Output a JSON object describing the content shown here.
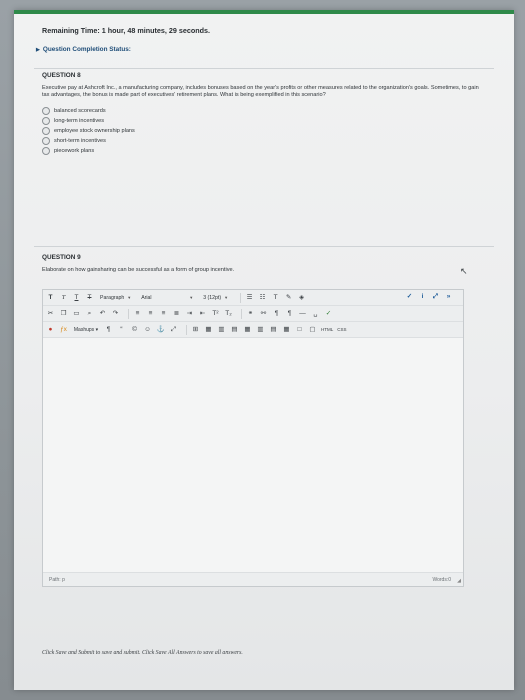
{
  "timer": "Remaining Time: 1 hour, 48 minutes, 29 seconds.",
  "status_label": "Question Completion Status:",
  "q8": {
    "heading": "QUESTION 8",
    "text": "Executive pay at Ashcroft Inc., a manufacturing company, includes bonuses based on the year's profits or other measures related to the organization's goals. Sometimes, to gain tax advantages, the bonus is made part of executives' retirement plans. What is being exemplified in this scenario?",
    "options": [
      "balanced scorecards",
      "long-term incentives",
      "employee stock ownership plans",
      "short-term incentives",
      "piecework plans"
    ]
  },
  "q9": {
    "heading": "QUESTION 9",
    "text": "Elaborate on how gainsharing can be successful as a form of group incentive."
  },
  "editor": {
    "format_select": "Paragraph",
    "font_select": "Arial",
    "size_select": "3 (12pt)",
    "mashups": "Mashups",
    "html_btn": "HTML",
    "css_btn": "CSS",
    "path_label": "Path: p",
    "words_label": "Words:0"
  },
  "footer": "Click Save and Submit to save and submit. Click Save All Answers to save all answers."
}
